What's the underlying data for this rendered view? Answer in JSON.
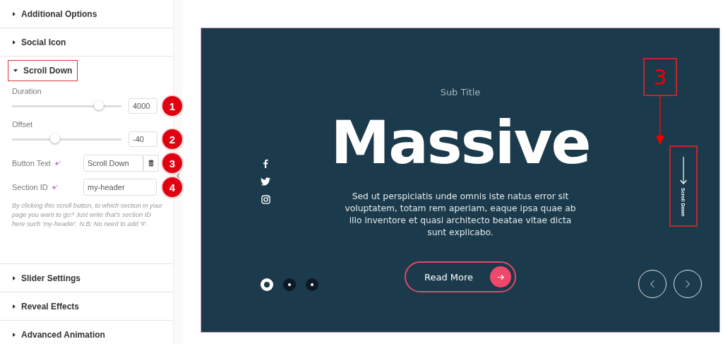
{
  "sidebar": {
    "sections_top": [
      {
        "title": "Additional Options",
        "expanded": false
      },
      {
        "title": "Social Icon",
        "expanded": false
      }
    ],
    "scroll_down": {
      "title": "Scroll Down",
      "expanded": true,
      "highlighted": true,
      "sliders": [
        {
          "label": "Duration",
          "level": 0.8,
          "value": "4000",
          "badge": "1"
        },
        {
          "label": "Offset",
          "level": 0.4,
          "value": "-40",
          "badge": "2"
        }
      ],
      "fields": [
        {
          "label": "Button Text",
          "value": "Scroll Down",
          "kind": "dynamic",
          "badge": "3"
        },
        {
          "label": "Section ID",
          "value": "my-header",
          "kind": "plain",
          "badge": "4"
        }
      ],
      "help": "By clicking this scroll button, to which section in your page you want to go? Just write that's section ID here such 'my-header'. N.B: No need to add '#'."
    },
    "sections_bottom": [
      {
        "title": "Slider Settings",
        "expanded": false
      },
      {
        "title": "Reveal Effects",
        "expanded": false
      },
      {
        "title": "Advanced Animation",
        "expanded": false
      }
    ]
  },
  "preview": {
    "subtitle": "Sub Title",
    "title": "Massive",
    "text": "Sed ut perspiciatis unde omnis iste natus error sit voluptatem, totam rem aperiam, eaque ipsa quae ab illo inventore et quasi architecto beatae vitae dicta sunt explicabo.",
    "button": "Read More",
    "scroll_button": "Scroll Down",
    "callout": "3",
    "dots": [
      {
        "selected": true
      },
      {
        "selected": false
      },
      {
        "selected": false
      }
    ]
  }
}
